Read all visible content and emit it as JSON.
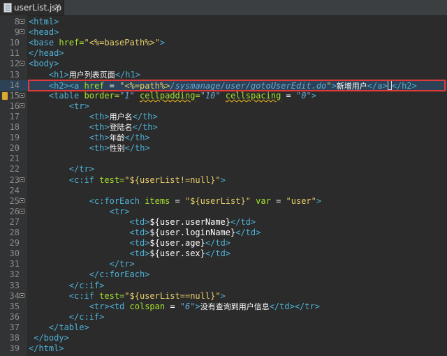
{
  "tab": {
    "label": "userList.jsp",
    "close": "✕",
    "icon": "jsp-file-icon"
  },
  "colors": {
    "tag": "#4fb1d6",
    "attribute": "#a6e22e",
    "string": "#e8cf6a",
    "highlight": "#e03a3a"
  },
  "lines": [
    {
      "n": "8",
      "tokens": [
        [
          "t",
          "<html>"
        ]
      ]
    },
    {
      "n": "9",
      "tokens": [
        [
          "t",
          "<head>"
        ]
      ]
    },
    {
      "n": "10",
      "tokens": [
        [
          "t",
          "<base "
        ],
        [
          "a",
          "href="
        ],
        [
          "s",
          "\"<%=basePath%>\""
        ],
        [
          "t",
          ">"
        ]
      ]
    },
    {
      "n": "11",
      "tokens": [
        [
          "t",
          "</head>"
        ]
      ]
    },
    {
      "n": "12",
      "tokens": [
        [
          "t",
          "<body>"
        ]
      ]
    },
    {
      "n": "13",
      "tokens": [
        [
          "p",
          "    "
        ],
        [
          "t",
          "<h1>"
        ],
        [
          "c",
          "用户列表页面"
        ],
        [
          "t",
          "</h1>"
        ]
      ]
    },
    {
      "n": "14",
      "tokens": [
        [
          "p",
          "    "
        ],
        [
          "t",
          "<h2>"
        ],
        [
          "t",
          "<a "
        ],
        [
          "a",
          "href"
        ],
        [
          "p",
          " = "
        ],
        [
          "s",
          "\"<%=path%>"
        ],
        [
          "i",
          "/sysmanage/user/gotoUserEdit.do"
        ],
        [
          "s",
          "\""
        ],
        [
          "t",
          ">"
        ],
        [
          "c",
          "新增用户"
        ],
        [
          "t",
          "</a>"
        ],
        [
          "cursor",
          ""
        ],
        [
          "t",
          "</h2>"
        ]
      ]
    },
    {
      "n": "15",
      "tokens": [
        [
          "p",
          "    "
        ],
        [
          "t",
          "<table "
        ],
        [
          "a",
          "border="
        ],
        [
          "i",
          "\"1\""
        ],
        [
          "p",
          " "
        ],
        [
          "aw",
          "cellpadding"
        ],
        [
          "a",
          "="
        ],
        [
          "i",
          "\"10\""
        ],
        [
          "p",
          " "
        ],
        [
          "aw",
          "cellspacing"
        ],
        [
          "p",
          " = "
        ],
        [
          "i",
          "\"0\""
        ],
        [
          "t",
          ">"
        ]
      ]
    },
    {
      "n": "16",
      "tokens": [
        [
          "p",
          "        "
        ],
        [
          "t",
          "<tr>"
        ]
      ]
    },
    {
      "n": "17",
      "tokens": [
        [
          "p",
          "            "
        ],
        [
          "t",
          "<th>"
        ],
        [
          "c",
          "用户名"
        ],
        [
          "t",
          "</th>"
        ]
      ]
    },
    {
      "n": "18",
      "tokens": [
        [
          "p",
          "            "
        ],
        [
          "t",
          "<th>"
        ],
        [
          "c",
          "登陆名"
        ],
        [
          "t",
          "</th>"
        ]
      ]
    },
    {
      "n": "19",
      "tokens": [
        [
          "p",
          "            "
        ],
        [
          "t",
          "<th>"
        ],
        [
          "c",
          "年龄"
        ],
        [
          "t",
          "</th>"
        ]
      ]
    },
    {
      "n": "20",
      "tokens": [
        [
          "p",
          "            "
        ],
        [
          "t",
          "<th>"
        ],
        [
          "c",
          "性别"
        ],
        [
          "t",
          "</th>"
        ]
      ]
    },
    {
      "n": "21",
      "tokens": []
    },
    {
      "n": "22",
      "tokens": [
        [
          "p",
          "        "
        ],
        [
          "t",
          "</tr>"
        ]
      ]
    },
    {
      "n": "23",
      "tokens": [
        [
          "p",
          "        "
        ],
        [
          "t",
          "<c:if "
        ],
        [
          "a",
          "test="
        ],
        [
          "s",
          "\"${userList!=null}\""
        ],
        [
          "t",
          ">"
        ]
      ]
    },
    {
      "n": "24",
      "tokens": []
    },
    {
      "n": "25",
      "tokens": [
        [
          "p",
          "            "
        ],
        [
          "t",
          "<c:forEach "
        ],
        [
          "a",
          "items"
        ],
        [
          "p",
          " = "
        ],
        [
          "s",
          "\"${userList}\""
        ],
        [
          "p",
          " "
        ],
        [
          "a",
          "var"
        ],
        [
          "p",
          " = "
        ],
        [
          "s",
          "\"user\""
        ],
        [
          "t",
          ">"
        ]
      ]
    },
    {
      "n": "26",
      "tokens": [
        [
          "p",
          "                "
        ],
        [
          "t",
          "<tr>"
        ]
      ]
    },
    {
      "n": "27",
      "tokens": [
        [
          "p",
          "                    "
        ],
        [
          "t",
          "<td>"
        ],
        [
          "p",
          "${user.userName}"
        ],
        [
          "t",
          "</td>"
        ]
      ]
    },
    {
      "n": "28",
      "tokens": [
        [
          "p",
          "                    "
        ],
        [
          "t",
          "<td>"
        ],
        [
          "p",
          "${user.loginName}"
        ],
        [
          "t",
          "</td>"
        ]
      ]
    },
    {
      "n": "29",
      "tokens": [
        [
          "p",
          "                    "
        ],
        [
          "t",
          "<td>"
        ],
        [
          "p",
          "${user.age}"
        ],
        [
          "t",
          "</td>"
        ]
      ]
    },
    {
      "n": "30",
      "tokens": [
        [
          "p",
          "                    "
        ],
        [
          "t",
          "<td>"
        ],
        [
          "p",
          "${user.sex}"
        ],
        [
          "t",
          "</td>"
        ]
      ]
    },
    {
      "n": "31",
      "tokens": [
        [
          "p",
          "                "
        ],
        [
          "t",
          "</tr>"
        ]
      ]
    },
    {
      "n": "32",
      "tokens": [
        [
          "p",
          "            "
        ],
        [
          "t",
          "</c:forEach>"
        ]
      ]
    },
    {
      "n": "33",
      "tokens": [
        [
          "p",
          "        "
        ],
        [
          "t",
          "</c:if>"
        ]
      ]
    },
    {
      "n": "34",
      "tokens": [
        [
          "p",
          "        "
        ],
        [
          "t",
          "<c:if "
        ],
        [
          "a",
          "test="
        ],
        [
          "s",
          "\"${userList==null}\""
        ],
        [
          "t",
          ">"
        ]
      ]
    },
    {
      "n": "35",
      "tokens": [
        [
          "p",
          "            "
        ],
        [
          "t",
          "<tr>"
        ],
        [
          "t",
          "<td "
        ],
        [
          "a",
          "colspan"
        ],
        [
          "p",
          " = "
        ],
        [
          "i",
          "\"6\""
        ],
        [
          "t",
          ">"
        ],
        [
          "c",
          "没有查询到用户信息"
        ],
        [
          "t",
          "</td>"
        ],
        [
          "t",
          "</tr>"
        ]
      ]
    },
    {
      "n": "36",
      "tokens": [
        [
          "p",
          "        "
        ],
        [
          "t",
          "</c:if>"
        ]
      ]
    },
    {
      "n": "37",
      "tokens": [
        [
          "p",
          "    "
        ],
        [
          "t",
          "</table>"
        ]
      ]
    },
    {
      "n": "38",
      "tokens": [
        [
          "p",
          " "
        ],
        [
          "t",
          "</body>"
        ]
      ]
    },
    {
      "n": "39",
      "tokens": [
        [
          "t",
          "</html>"
        ]
      ]
    }
  ]
}
